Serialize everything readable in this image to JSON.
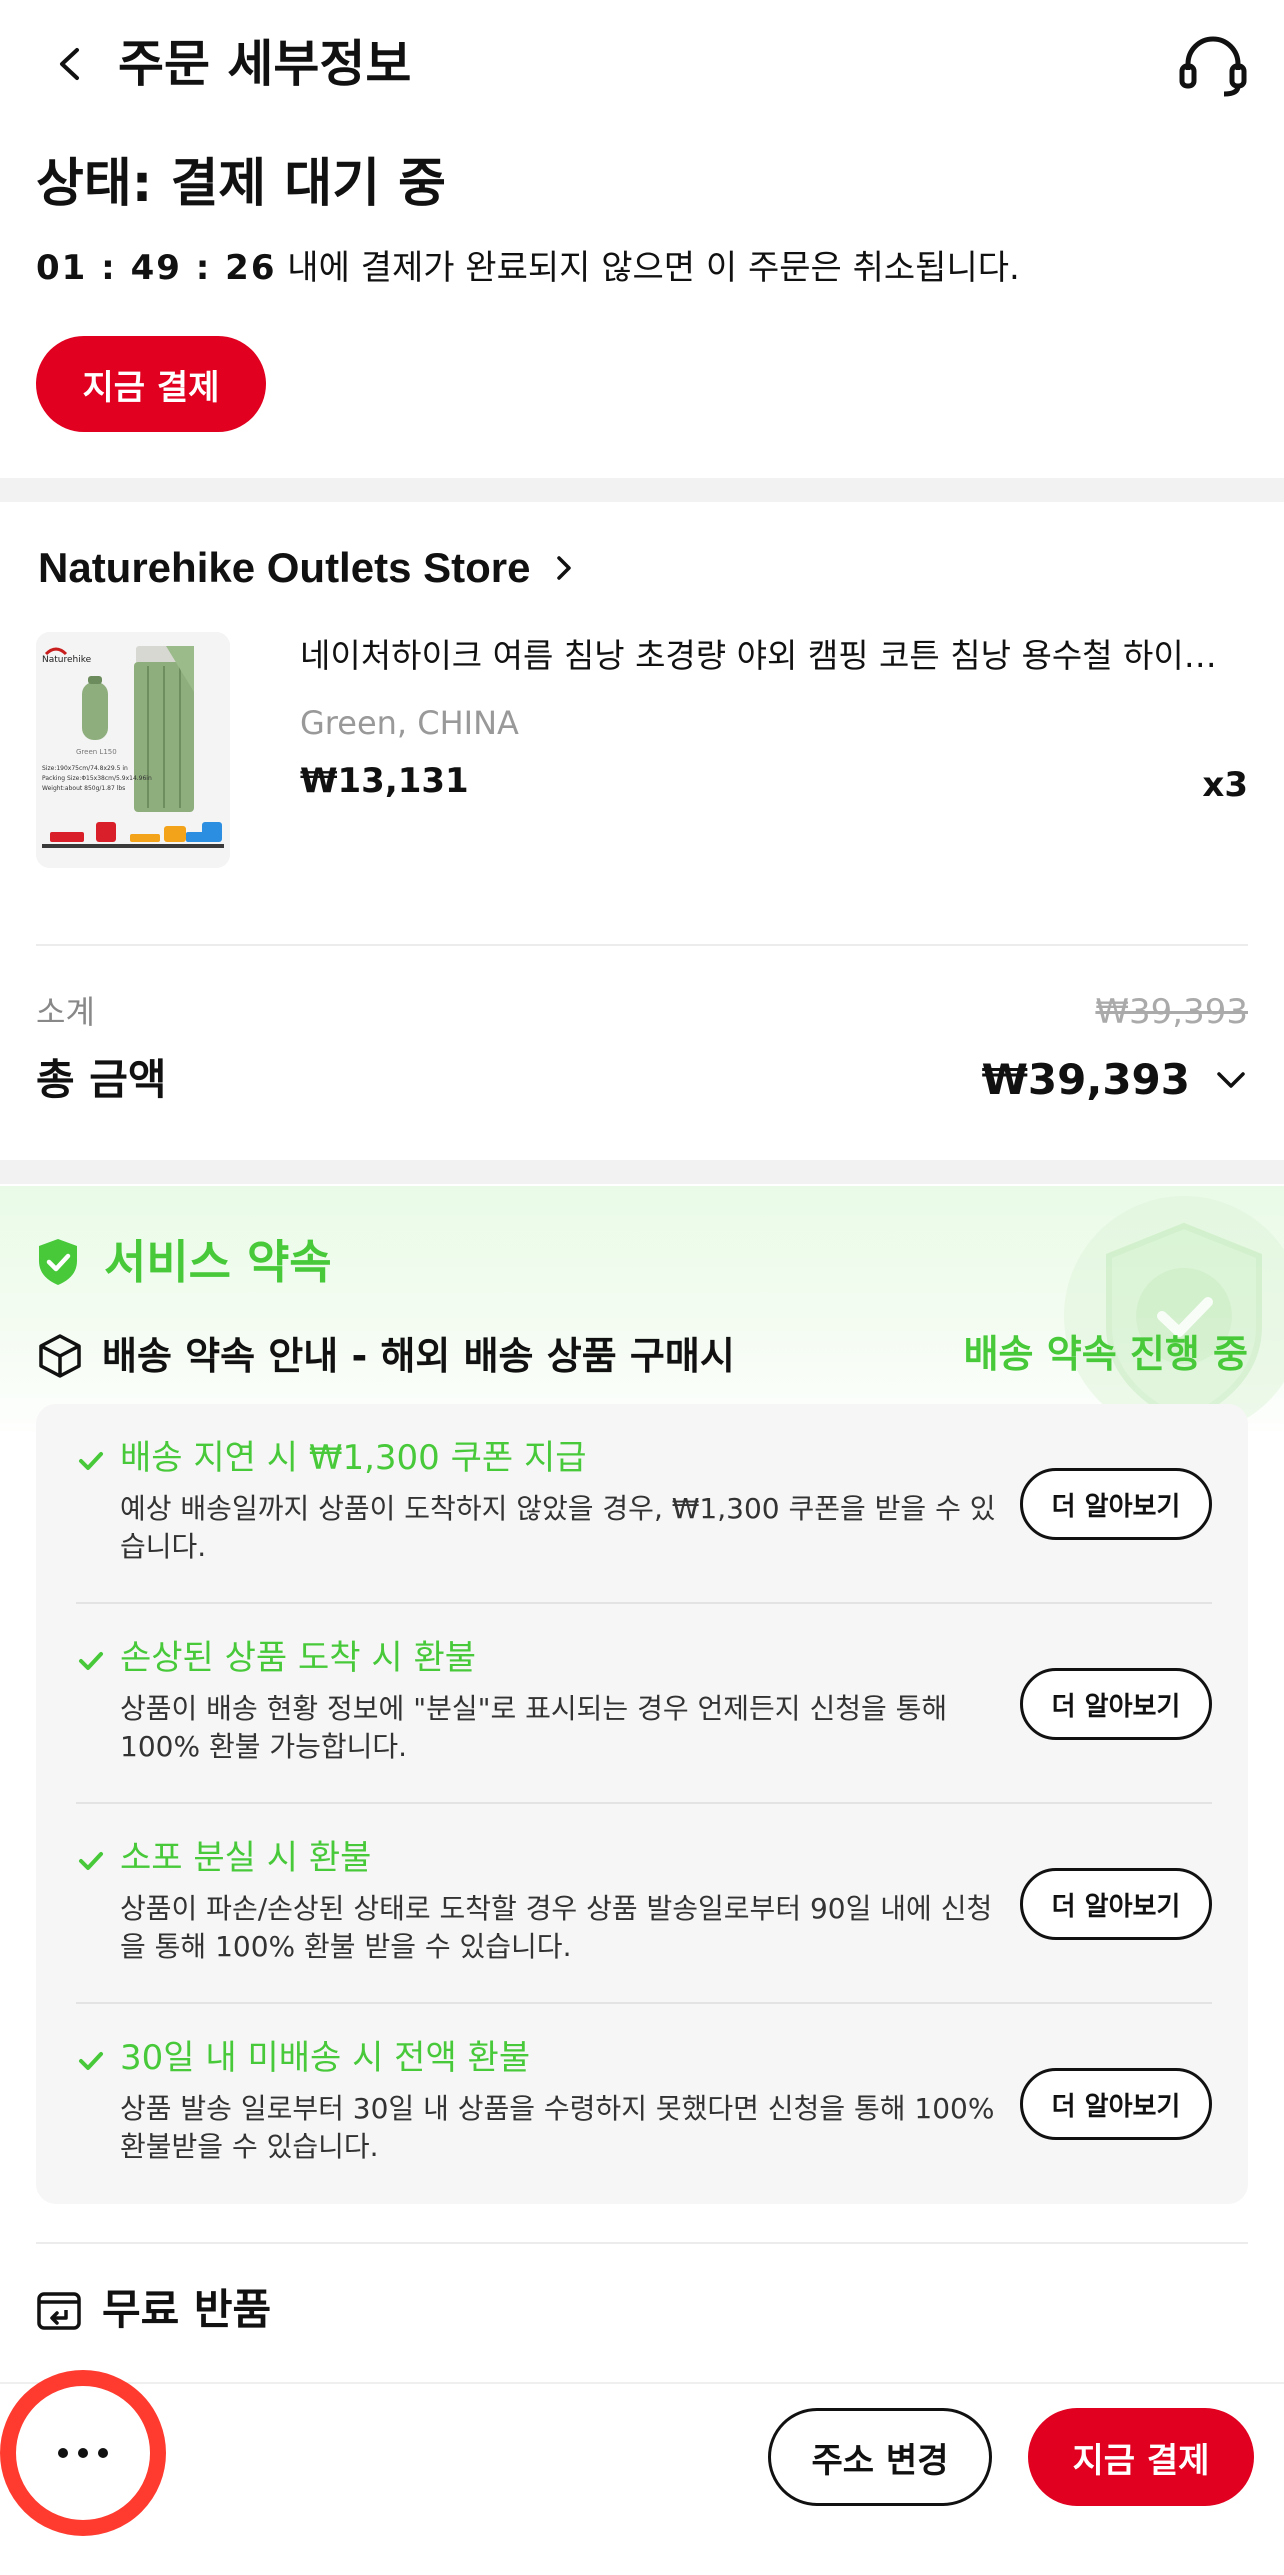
{
  "header": {
    "title": "주문 세부정보",
    "back_icon": "chevron-left-icon",
    "support_icon": "headset-icon"
  },
  "status": {
    "title": "상태: 결제 대기 중",
    "countdown": "01 : 49 : 26",
    "countdown_suffix": " 내에 결제가 완료되지 않으면 이 주문은 취소됩니다.",
    "pay_now_label": "지금 결제"
  },
  "store": {
    "name": "Naturehike Outlets Store",
    "chevron_icon": "chevron-right-icon"
  },
  "product": {
    "name": "네이처하이크 여름 침낭 초경량 야외 캠핑 코튼 침낭 용수철 하이…",
    "variant": "Green, CHINA",
    "price": "₩13,131",
    "quantity": "x3",
    "thumb": {
      "brand": "Naturehike",
      "model": "Green L150",
      "spec_line1": "Size:190x75cm/74.8x29.5 in",
      "spec_line2": "Packing Size:Φ15x38cm/5.9x14.96in",
      "spec_line3": "Weight:about 850g/1.87 lbs"
    }
  },
  "summary": {
    "subtotal_label": "소계",
    "subtotal_value": "₩39,393",
    "total_label": "총 금액",
    "total_value": "₩39,393"
  },
  "service": {
    "title": "서비스 약속",
    "delivery_title": "배송 약속 안내 - 해외 배송 상품 구매시",
    "delivery_status": "배송 약속 진행 중",
    "items": [
      {
        "title": "배송 지연 시 ₩1,300 쿠폰 지급",
        "desc": "예상 배송일까지 상품이 도착하지 않았을 경우, ₩1,300 쿠폰을 받을 수 있습니다.",
        "button": "더 알아보기"
      },
      {
        "title": "손상된 상품 도착 시 환불",
        "desc": "상품이 배송 현황 정보에 \"분실\"로 표시되는 경우 언제든지 신청을 통해 100% 환불 가능합니다.",
        "button": "더 알아보기"
      },
      {
        "title": "소포 분실 시 환불",
        "desc": "상품이 파손/손상된 상태로 도착할 경우 상품 발송일로부터 90일 내에 신청을 통해 100% 환불 받을 수 있습니다.",
        "button": "더 알아보기"
      },
      {
        "title": "30일 내 미배송 시 전액 환불",
        "desc": "상품 발송 일로부터 30일 내 상품을 수령하지 못했다면 신청을 통해 100% 환불받을 수 있습니다.",
        "button": "더 알아보기"
      }
    ],
    "free_return_title": "무료 반품"
  },
  "bottom_bar": {
    "change_address_label": "주소 변경",
    "pay_now_label": "지금 결제",
    "more_icon": "more-dots-icon"
  },
  "colors": {
    "brand_red": "#e1001f",
    "promise_green": "#47c93a",
    "highlight_ring": "#ff3b30"
  }
}
